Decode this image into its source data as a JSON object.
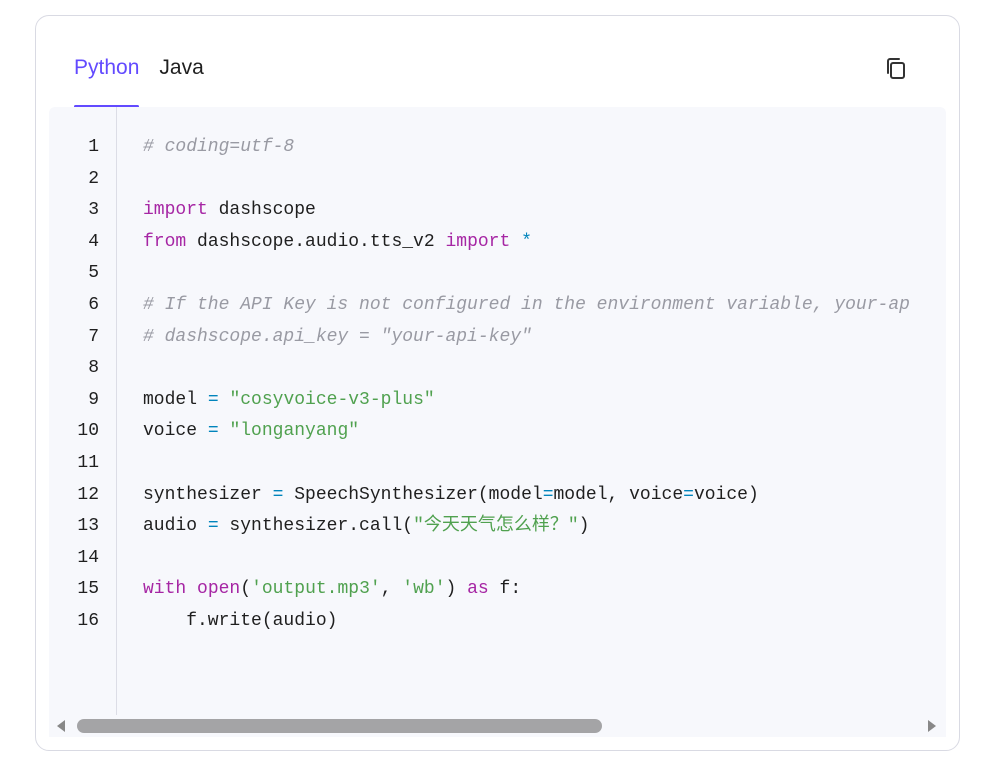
{
  "tabs": [
    {
      "label": "Python",
      "active": true
    },
    {
      "label": "Java",
      "active": false
    }
  ],
  "copy_button": {
    "icon": "copy-icon"
  },
  "code": {
    "language": "python",
    "line_numbers": [
      "1",
      "2",
      "3",
      "4",
      "5",
      "6",
      "7",
      "8",
      "9",
      "10",
      "11",
      "12",
      "13",
      "14",
      "15",
      "16"
    ],
    "lines": [
      "# coding=utf-8",
      "",
      "import dashscope",
      "from dashscope.audio.tts_v2 import *",
      "",
      "# If the API Key is not configured in the environment variable, your-ap",
      "# dashscope.api_key = \"your-api-key\"",
      "",
      "model = \"cosyvoice-v3-plus\"",
      "voice = \"longanyang\"",
      "",
      "synthesizer = SpeechSynthesizer(model=model, voice=voice)",
      "audio = synthesizer.call(\"今天天气怎么样？\")",
      "",
      "with open('output.mp3', 'wb') as f:",
      "    f.write(audio)"
    ]
  },
  "scrollbar": {
    "horizontal_position": 0.0,
    "visible_fraction": 0.6
  },
  "colors": {
    "accent": "#624aff",
    "comment": "#999aa3",
    "keyword": "#a626a4",
    "string": "#50a14f",
    "operator": "#0184bc"
  }
}
